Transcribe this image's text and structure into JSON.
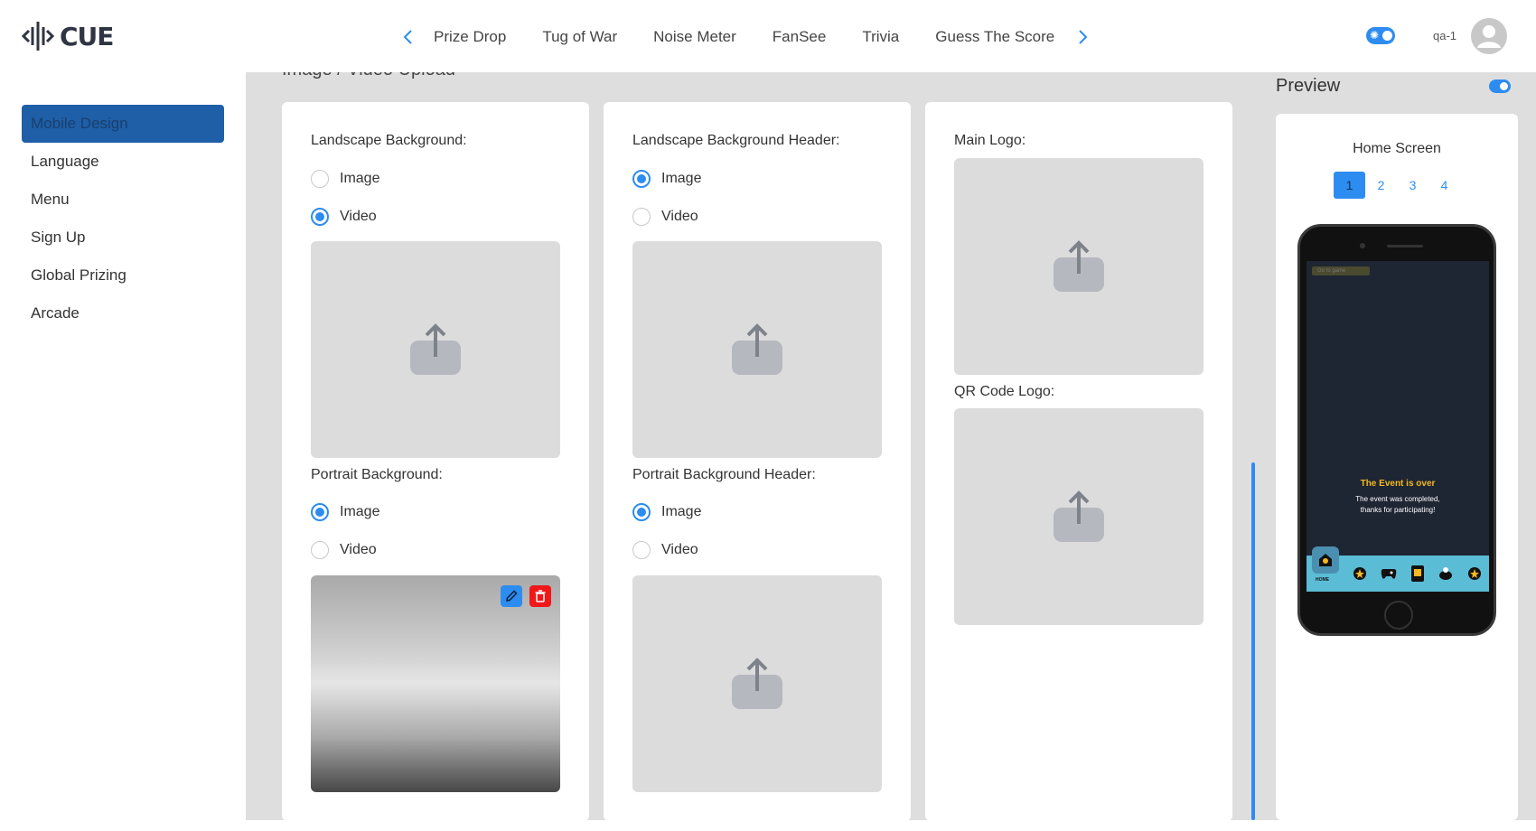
{
  "app": {
    "logo_text": "CUE"
  },
  "game_nav": {
    "tabs": [
      "Prize Drop",
      "Tug of War",
      "Noise Meter",
      "FanSee",
      "Trivia",
      "Guess The Score"
    ]
  },
  "header": {
    "user_name": "qa-1"
  },
  "sidebar": {
    "items": [
      {
        "label": "Mobile Design",
        "active": true
      },
      {
        "label": "Language"
      },
      {
        "label": "Menu"
      },
      {
        "label": "Sign Up"
      },
      {
        "label": "Global Prizing"
      },
      {
        "label": "Arcade"
      }
    ]
  },
  "main": {
    "section_title": "Image / Video Upload",
    "option_image": "Image",
    "option_video": "Video",
    "col1": {
      "landscape_label": "Landscape Background:",
      "landscape_selected": "Video",
      "portrait_label": "Portrait Background:",
      "portrait_selected": "Image"
    },
    "col2": {
      "landscape_label": "Landscape Background Header:",
      "landscape_selected": "Image",
      "portrait_label": "Portrait Background Header:",
      "portrait_selected": "Image"
    },
    "col3": {
      "main_logo_label": "Main Logo:",
      "qr_logo_label": "QR Code Logo:"
    }
  },
  "preview": {
    "title": "Preview",
    "screen_name": "Home Screen",
    "pages": [
      "1",
      "2",
      "3",
      "4"
    ],
    "active_page": "1",
    "phone": {
      "goto_button": "Go to game",
      "event_title": "The Event is over",
      "event_line1": "The event was completed,",
      "event_line2": "thanks for participating!",
      "home_label": "HOME"
    }
  },
  "colors": {
    "accent": "#2d8cf0",
    "sidebar_active": "#1e5fa8",
    "delete": "#f01818",
    "event_title": "#f5b820",
    "tabbar": "#5bbcd6"
  }
}
